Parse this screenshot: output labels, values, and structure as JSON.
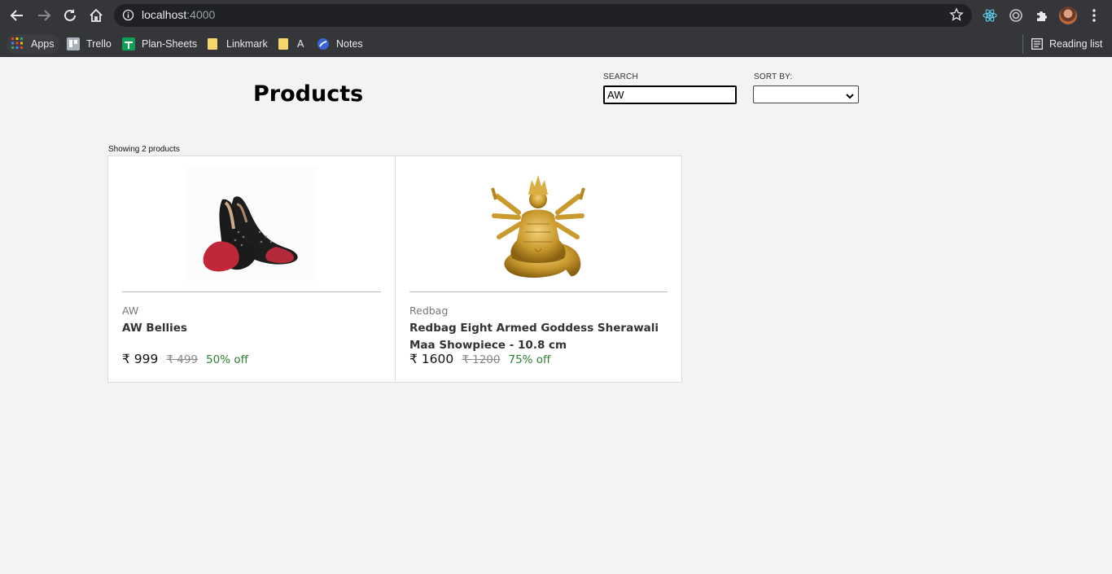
{
  "browser": {
    "url_host": "localhost",
    "url_port": ":4000",
    "bookmarks": [
      "Apps",
      "Trello",
      "Plan-Sheets",
      "Linkmark",
      "A",
      "Notes"
    ],
    "reading_list": "Reading list"
  },
  "header": {
    "title": "Products",
    "search_label": "SEARCH",
    "search_value": "AW",
    "sort_label": "SORT BY:",
    "sort_value": ""
  },
  "results": {
    "count_text": "Showing 2 products"
  },
  "products": [
    {
      "brand": "AW",
      "name": "AW Bellies",
      "price": "₹ 999",
      "mrp": "₹ 499",
      "discount": "50% off"
    },
    {
      "brand": "Redbag",
      "name": "Redbag Eight Armed Goddess Sherawali Maa Showpiece - 10.8 cm",
      "price": "₹ 1600",
      "mrp": "₹ 1200",
      "discount": "75% off"
    }
  ],
  "colors": {
    "chrome": "#35363a",
    "page_bg": "#f3f3f3",
    "discount": "#2e7d32"
  }
}
